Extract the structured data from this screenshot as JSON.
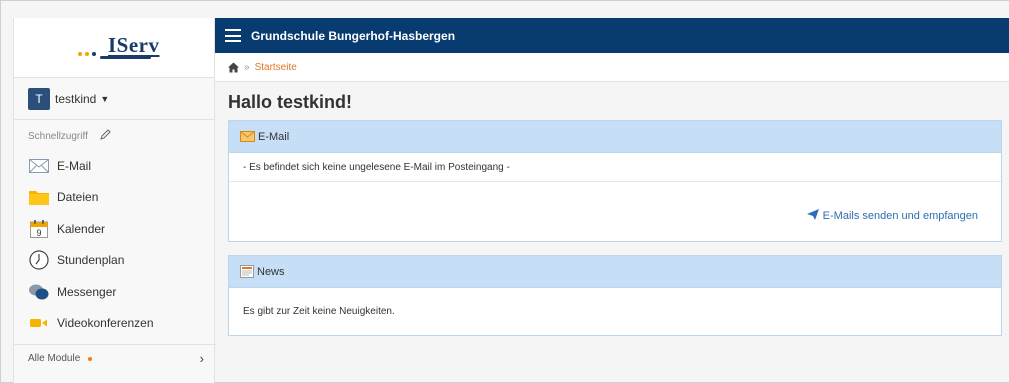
{
  "app": {
    "brand": "IServ",
    "school_name": "Grundschule Bungerhof-Hasbergen"
  },
  "user": {
    "avatar_letter": "T",
    "name": "testkind"
  },
  "sidebar": {
    "quick_access_label": "Schnellzugriff",
    "items": [
      {
        "label": "E-Mail",
        "icon": "mail-icon"
      },
      {
        "label": "Dateien",
        "icon": "folder-icon"
      },
      {
        "label": "Kalender",
        "icon": "calendar-icon",
        "calendar_day": "9"
      },
      {
        "label": "Stundenplan",
        "icon": "clock-icon"
      },
      {
        "label": "Messenger",
        "icon": "chat-icon"
      },
      {
        "label": "Videokonferenzen",
        "icon": "video-icon"
      }
    ],
    "all_modules_label": "Alle Module"
  },
  "breadcrumb": {
    "separator": "»",
    "current": "Startseite"
  },
  "main": {
    "greeting": "Hallo testkind!",
    "email_panel": {
      "title": "E-Mail",
      "message": "- Es befindet sich keine ungelesene E-Mail im Posteingang -",
      "action_label": "E-Mails senden und empfangen"
    },
    "news_panel": {
      "title": "News",
      "message": "Es gibt zur Zeit keine Neuigkeiten."
    }
  },
  "colors": {
    "topbar": "#083b6f",
    "accent_orange": "#e0752b",
    "panel_header": "#c7dff6",
    "link_blue": "#2d6fb3"
  }
}
